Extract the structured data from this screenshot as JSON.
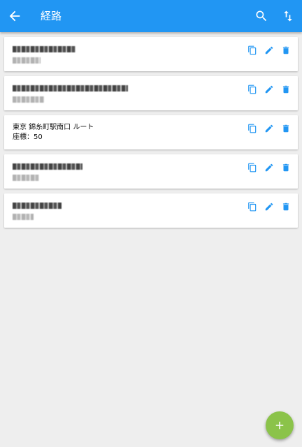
{
  "appbar": {
    "title": "経路",
    "back_icon": "arrow-back-icon",
    "search_icon": "search-icon",
    "sort_icon": "sort-icon",
    "color": "#2196f3"
  },
  "routes": [
    {
      "name": "",
      "coords_label": "",
      "redacted": true
    },
    {
      "name": "",
      "coords_label": "",
      "redacted": true
    },
    {
      "name": "東京 錦糸町駅南口 ルート",
      "coords_label": "座標：50",
      "redacted": false
    },
    {
      "name": "",
      "coords_label": "",
      "redacted": true
    },
    {
      "name": "",
      "coords_label": "",
      "redacted": true
    }
  ],
  "row_actions": {
    "copy_icon": "copy-icon",
    "edit_icon": "edit-icon",
    "delete_icon": "delete-icon",
    "copy_color": "#2196f3",
    "edit_color": "#2196f3",
    "delete_color": "#2196f3"
  },
  "fab": {
    "icon": "add-icon",
    "color": "#8bc34a"
  }
}
